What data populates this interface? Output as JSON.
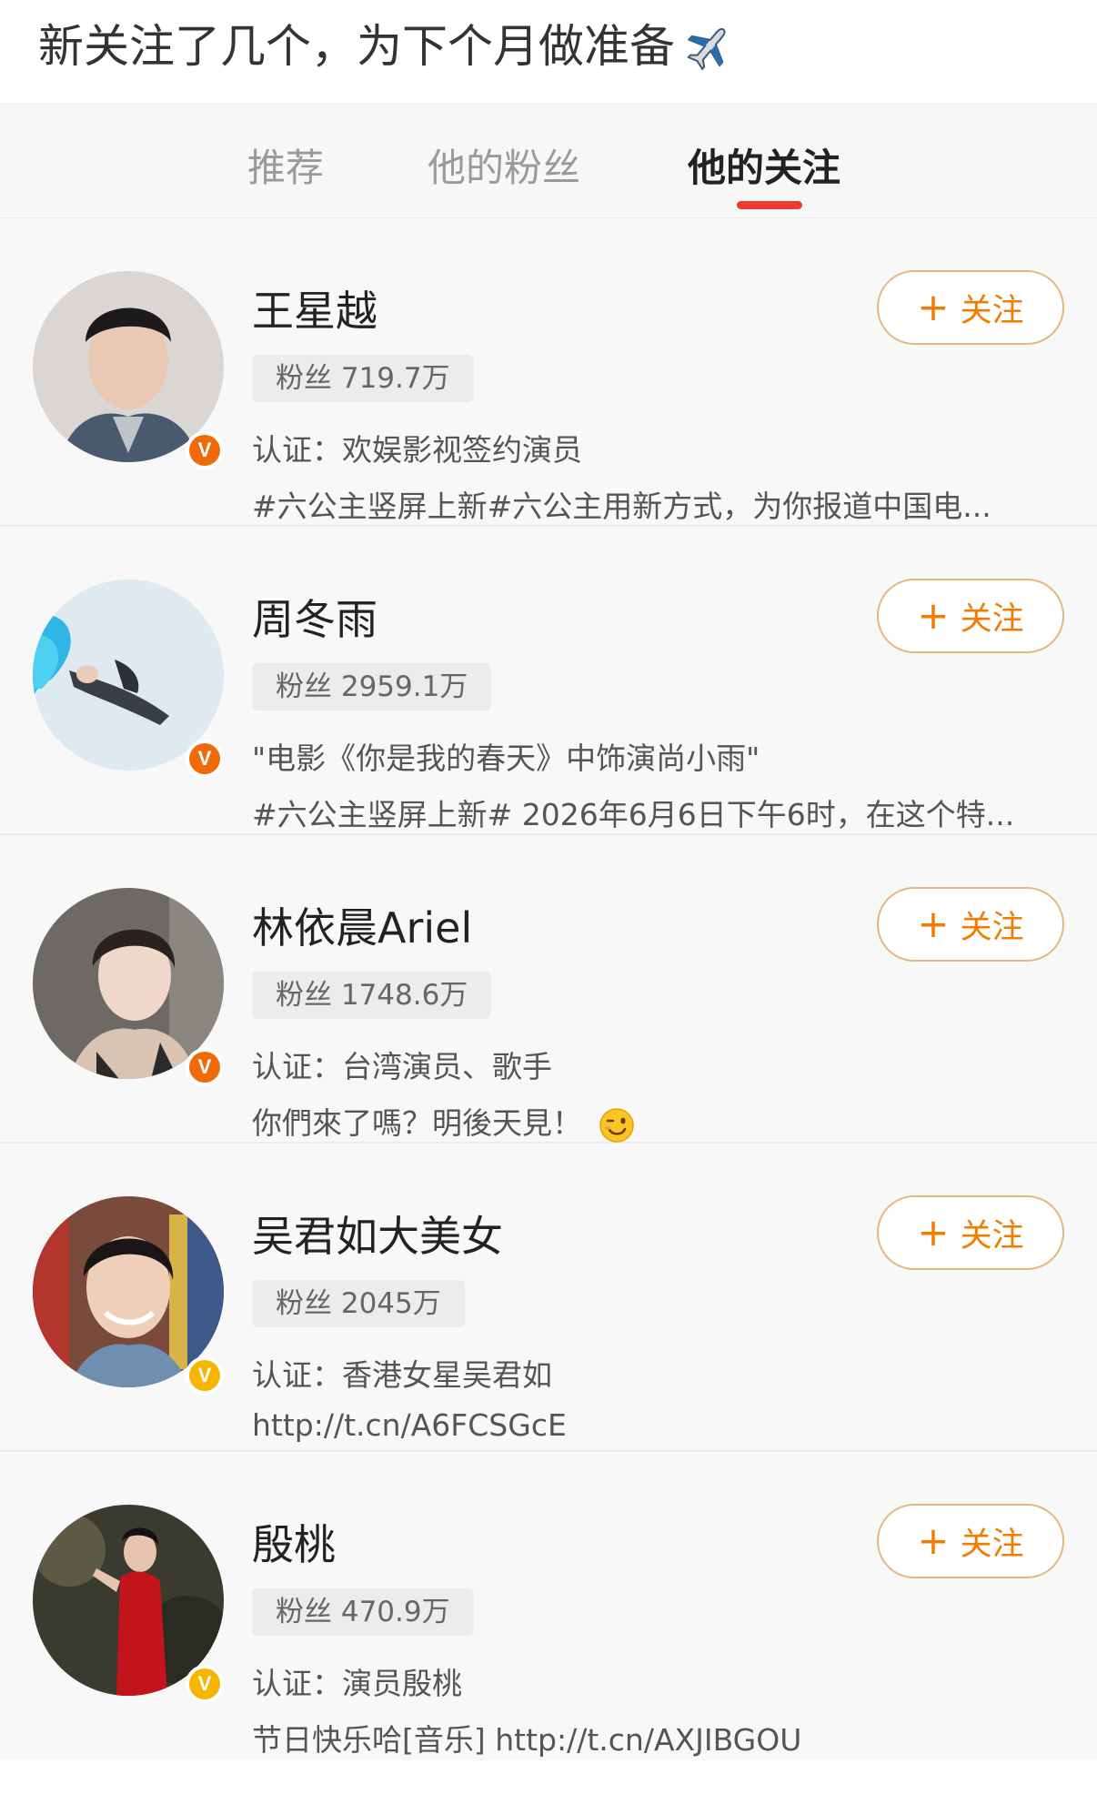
{
  "post": {
    "title": "新关注了几个，为下个月做准备",
    "emoji_icon": "airplane-icon"
  },
  "tabs": [
    {
      "label": "推荐",
      "active": false
    },
    {
      "label": "他的粉丝",
      "active": false
    },
    {
      "label": "他的关注",
      "active": true
    }
  ],
  "follow_label": "关注",
  "users": [
    {
      "name": "王星越",
      "fans": "粉丝 719.7万",
      "desc": "认证：欢娱影视签约演员",
      "extra": "#六公主竖屏上新#六公主用新方式，为你报道中国电...",
      "badge": "orange"
    },
    {
      "name": "周冬雨",
      "fans": "粉丝 2959.1万",
      "desc": "\"电影《你是我的春天》中饰演尚小雨\"",
      "extra": "#六公主竖屏上新# 2026年6月6日下午6时，在这个特...",
      "badge": "orange"
    },
    {
      "name": "林依晨Ariel",
      "fans": "粉丝 1748.6万",
      "desc": "认证：台湾演员、歌手",
      "extra": "你們來了嗎？明後天見！",
      "badge": "orange"
    },
    {
      "name": "吴君如大美女",
      "fans": "粉丝 2045万",
      "desc": "认证：香港女星吴君如",
      "extra": "http://t.cn/A6FCSGcE",
      "badge": "yellow"
    },
    {
      "name": "殷桃",
      "fans": "粉丝 470.9万",
      "desc": "认证：演员殷桃",
      "extra": "节日快乐哈[音乐] http://t.cn/AXJIBGOU",
      "badge": "yellow"
    }
  ],
  "badge_letter": "V",
  "colors": {
    "accent_orange": "#f27c00",
    "tab_indicator": "#ee3b2f",
    "badge_orange": "#f06a0a",
    "badge_yellow": "#f7b500"
  }
}
